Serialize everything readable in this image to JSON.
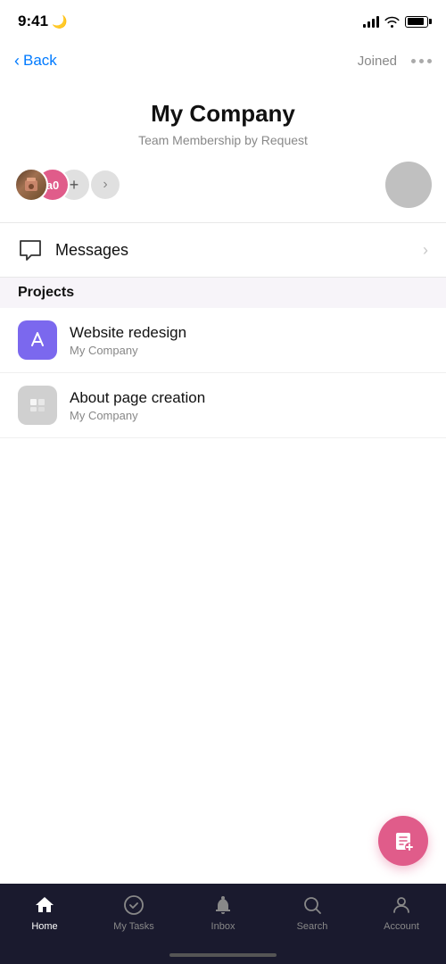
{
  "status_bar": {
    "time": "9:41",
    "moon": "🌙"
  },
  "nav": {
    "back_label": "Back",
    "joined_label": "Joined"
  },
  "team": {
    "name": "My Company",
    "subtitle": "Team Membership by Request",
    "member_initials": "a0",
    "add_icon": "+"
  },
  "messages": {
    "label": "Messages"
  },
  "projects_section": {
    "title": "Projects"
  },
  "projects": [
    {
      "name": "Website redesign",
      "team": "My Company",
      "icon_type": "purple"
    },
    {
      "name": "About page creation",
      "team": "My Company",
      "icon_type": "gray"
    }
  ],
  "bottom_nav": {
    "items": [
      {
        "id": "home",
        "label": "Home",
        "active": true
      },
      {
        "id": "my-tasks",
        "label": "My Tasks",
        "active": false
      },
      {
        "id": "inbox",
        "label": "Inbox",
        "active": false
      },
      {
        "id": "search",
        "label": "Search",
        "active": false
      },
      {
        "id": "account",
        "label": "Account",
        "active": false
      }
    ]
  }
}
